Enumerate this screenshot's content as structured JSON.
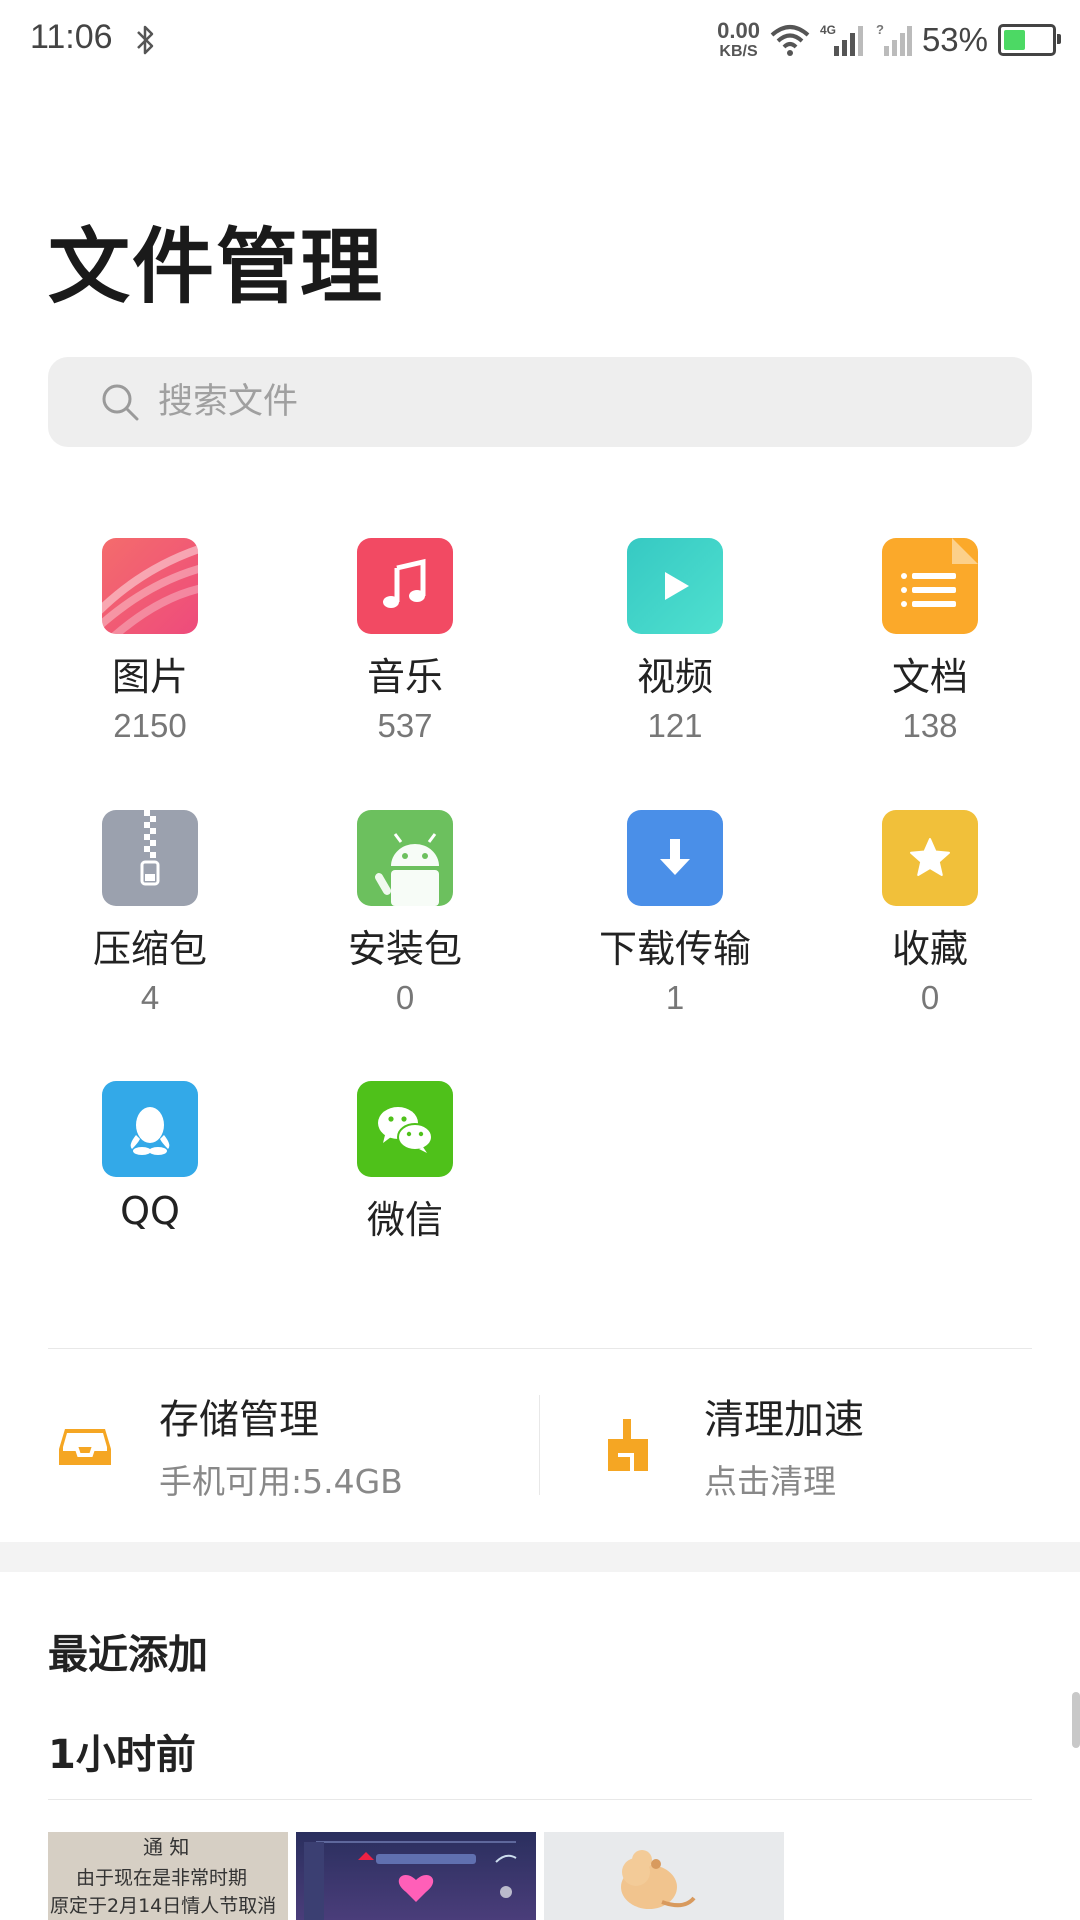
{
  "status_bar": {
    "time": "11:06",
    "net_speed_value": "0.00",
    "net_speed_unit": "KB/S",
    "network_type": "4G",
    "battery_percent": "53%",
    "battery_level": 0.53,
    "battery_color": "#4cd964"
  },
  "page": {
    "title": "文件管理"
  },
  "search": {
    "placeholder": "搜索文件"
  },
  "categories": [
    {
      "name": "图片",
      "count": "2150",
      "icon": "image-icon",
      "color": "#f0506e"
    },
    {
      "name": "音乐",
      "count": "537",
      "icon": "music-icon",
      "color": "#f24a63"
    },
    {
      "name": "视频",
      "count": "121",
      "icon": "video-icon",
      "color": "#3ed2c6"
    },
    {
      "name": "文档",
      "count": "138",
      "icon": "document-icon",
      "color": "#fba92a"
    },
    {
      "name": "压缩包",
      "count": "4",
      "icon": "zip-icon",
      "color": "#9ba1ae"
    },
    {
      "name": "安装包",
      "count": "0",
      "icon": "android-icon",
      "color": "#6cc05e"
    },
    {
      "name": "下载传输",
      "count": "1",
      "icon": "download-icon",
      "color": "#4a8fe8"
    },
    {
      "name": "收藏",
      "count": "0",
      "icon": "star-icon",
      "color": "#f1c03a"
    },
    {
      "name": "QQ",
      "count": "",
      "icon": "qq-icon",
      "color": "#33a9e8"
    },
    {
      "name": "微信",
      "count": "",
      "icon": "wechat-icon",
      "color": "#4fc11a"
    }
  ],
  "tools": {
    "storage": {
      "title": "存储管理",
      "subtitle": "手机可用:5.4GB",
      "icon": "storage-icon",
      "color": "#f5a623"
    },
    "cleanup": {
      "title": "清理加速",
      "subtitle": "点击清理",
      "icon": "broom-icon",
      "color": "#f5a623"
    }
  },
  "recent": {
    "title": "最近添加",
    "group_label": "1小时前",
    "thumbnails": [
      {
        "name": "notice-photo-thumbnail",
        "text_line1": "通 知",
        "text_line2": "由于现在是非常时期",
        "text_line3": "原定于2月14日情人节取消"
      },
      {
        "name": "game-screenshot-thumbnail"
      },
      {
        "name": "cartoon-image-thumbnail"
      }
    ]
  }
}
